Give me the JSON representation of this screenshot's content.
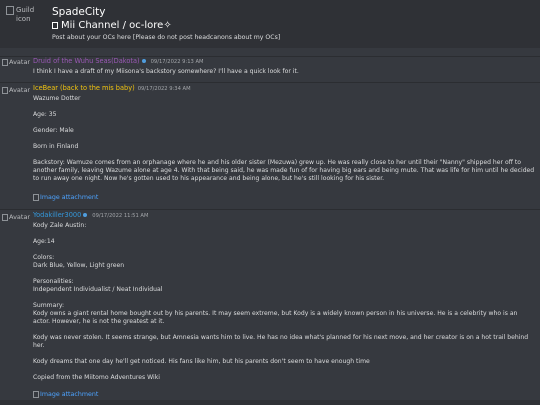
{
  "header": {
    "guild_icon_alt": "Guild icon",
    "guild_name": "SpadeCity",
    "channel_name": "Mii Channel / oc-lore",
    "channel_sparkle": "✧",
    "topic": "Post about your OCs here [Please do not post headcanons about my OCs]"
  },
  "avatar_alt": "Avatar",
  "attachment_alt": "Image attachment",
  "colors": {
    "background": "#36393f",
    "header_bg": "#2f3136",
    "text": "#dcddde",
    "link": "#4da3ff",
    "timestamp": "#a3a6aa"
  },
  "messages": [
    {
      "author": "Druid of the Wuhu Seas(Dakota)",
      "author_color": "#9b59b6",
      "has_bot_dot": true,
      "timestamp": "09/17/2022 9:13 AM",
      "lines": [
        "I think I have a draft of my Miisona's backstory somewhere? I'll have a quick look for it."
      ]
    },
    {
      "author": "IceBear (back to the mis baby)",
      "author_color": "#f1c40f",
      "has_bot_dot": false,
      "timestamp": "09/17/2022 9:34 AM",
      "lines": [
        "Wazume Dotter",
        "",
        "Age: 35",
        "",
        "Gender: Male",
        "",
        "Born in Finland",
        "",
        "Backstory: Wamuze comes from an orphanage where he and his older sister (Mezuwa) grew up. He was really close to her until their \"Nanny\" shipped her off to another family, leaving Wazume alone at age 4. With that being said, he was made fun of for having big ears and being mute. That was life for him until he decided to run away one night. Now he's gotten used to his appearance and being alone, but he's still looking for his sister."
      ],
      "attachment": "Image attachment"
    },
    {
      "author": "Yodakiller3000",
      "author_color": "#3498db",
      "has_bot_dot": true,
      "timestamp": "09/17/2022 11:51 AM",
      "lines": [
        "Kody Zale Austin:",
        "",
        "Age:14",
        "",
        "Colors:",
        "Dark Blue, Yellow, Light green",
        "",
        "Personalities:",
        "Independent Individualist / Neat Individual",
        "",
        "Summary:",
        "Kody owns a giant rental home bought out by his parents. It may seem extreme, but Kody is a widely known person in his universe. He is a celebrity who is an actor. However, he is not the greatest at it.",
        "",
        "Kody was never stolen. It seems strange, but Amnesia wants him to live. He has no idea what's planned for his next move, and her creator is on a hot trail behind her.",
        "",
        "Kody dreams that one day he'll get noticed. His fans like him, but his parents don't seem to have enough time",
        "",
        "Copied from the Miitomo Adventures Wiki"
      ],
      "attachment": "Image attachment"
    }
  ]
}
